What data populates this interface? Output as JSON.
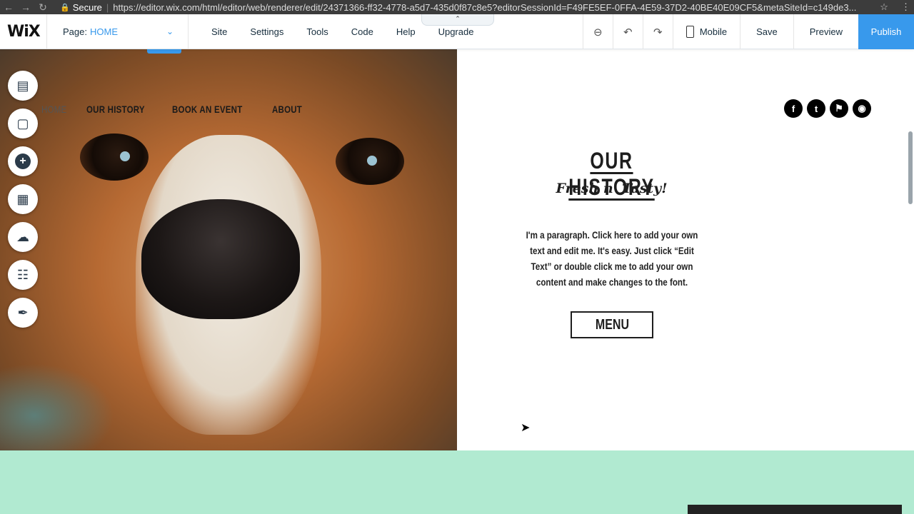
{
  "browser": {
    "secure_label": "Secure",
    "url": "https://editor.wix.com/html/editor/web/renderer/edit/24371366-ff32-4778-a5d7-435d0f87c8e5?editorSessionId=F49FE5EF-0FFA-4E59-37D2-40BE40E09CF5&metaSiteId=c149de3..."
  },
  "editor": {
    "logo": "WiX",
    "page_label": "Page:",
    "page_value": "HOME",
    "menu": [
      "Site",
      "Settings",
      "Tools",
      "Code",
      "Help",
      "Upgrade"
    ],
    "mobile_label": "Mobile",
    "save_label": "Save",
    "preview_label": "Preview",
    "publish_label": "Publish",
    "accent_color": "#3899ec"
  },
  "site": {
    "nav": [
      "HOME",
      "OUR HISTORY",
      "BOOK AN EVENT",
      "ABOUT"
    ],
    "social": [
      "facebook-icon",
      "twitter-icon",
      "foursquare-icon",
      "instagram-icon"
    ],
    "title": "OUR HISTORY",
    "subtitle": "Fresh n' Tasty!",
    "paragraph": "I'm a paragraph. Click here to add your own text and edit me. It's easy. Just click “Edit Text” or double click me to add your own content and make changes to the font.",
    "menu_button": "MENU",
    "footer_color": "#b1ead1"
  }
}
